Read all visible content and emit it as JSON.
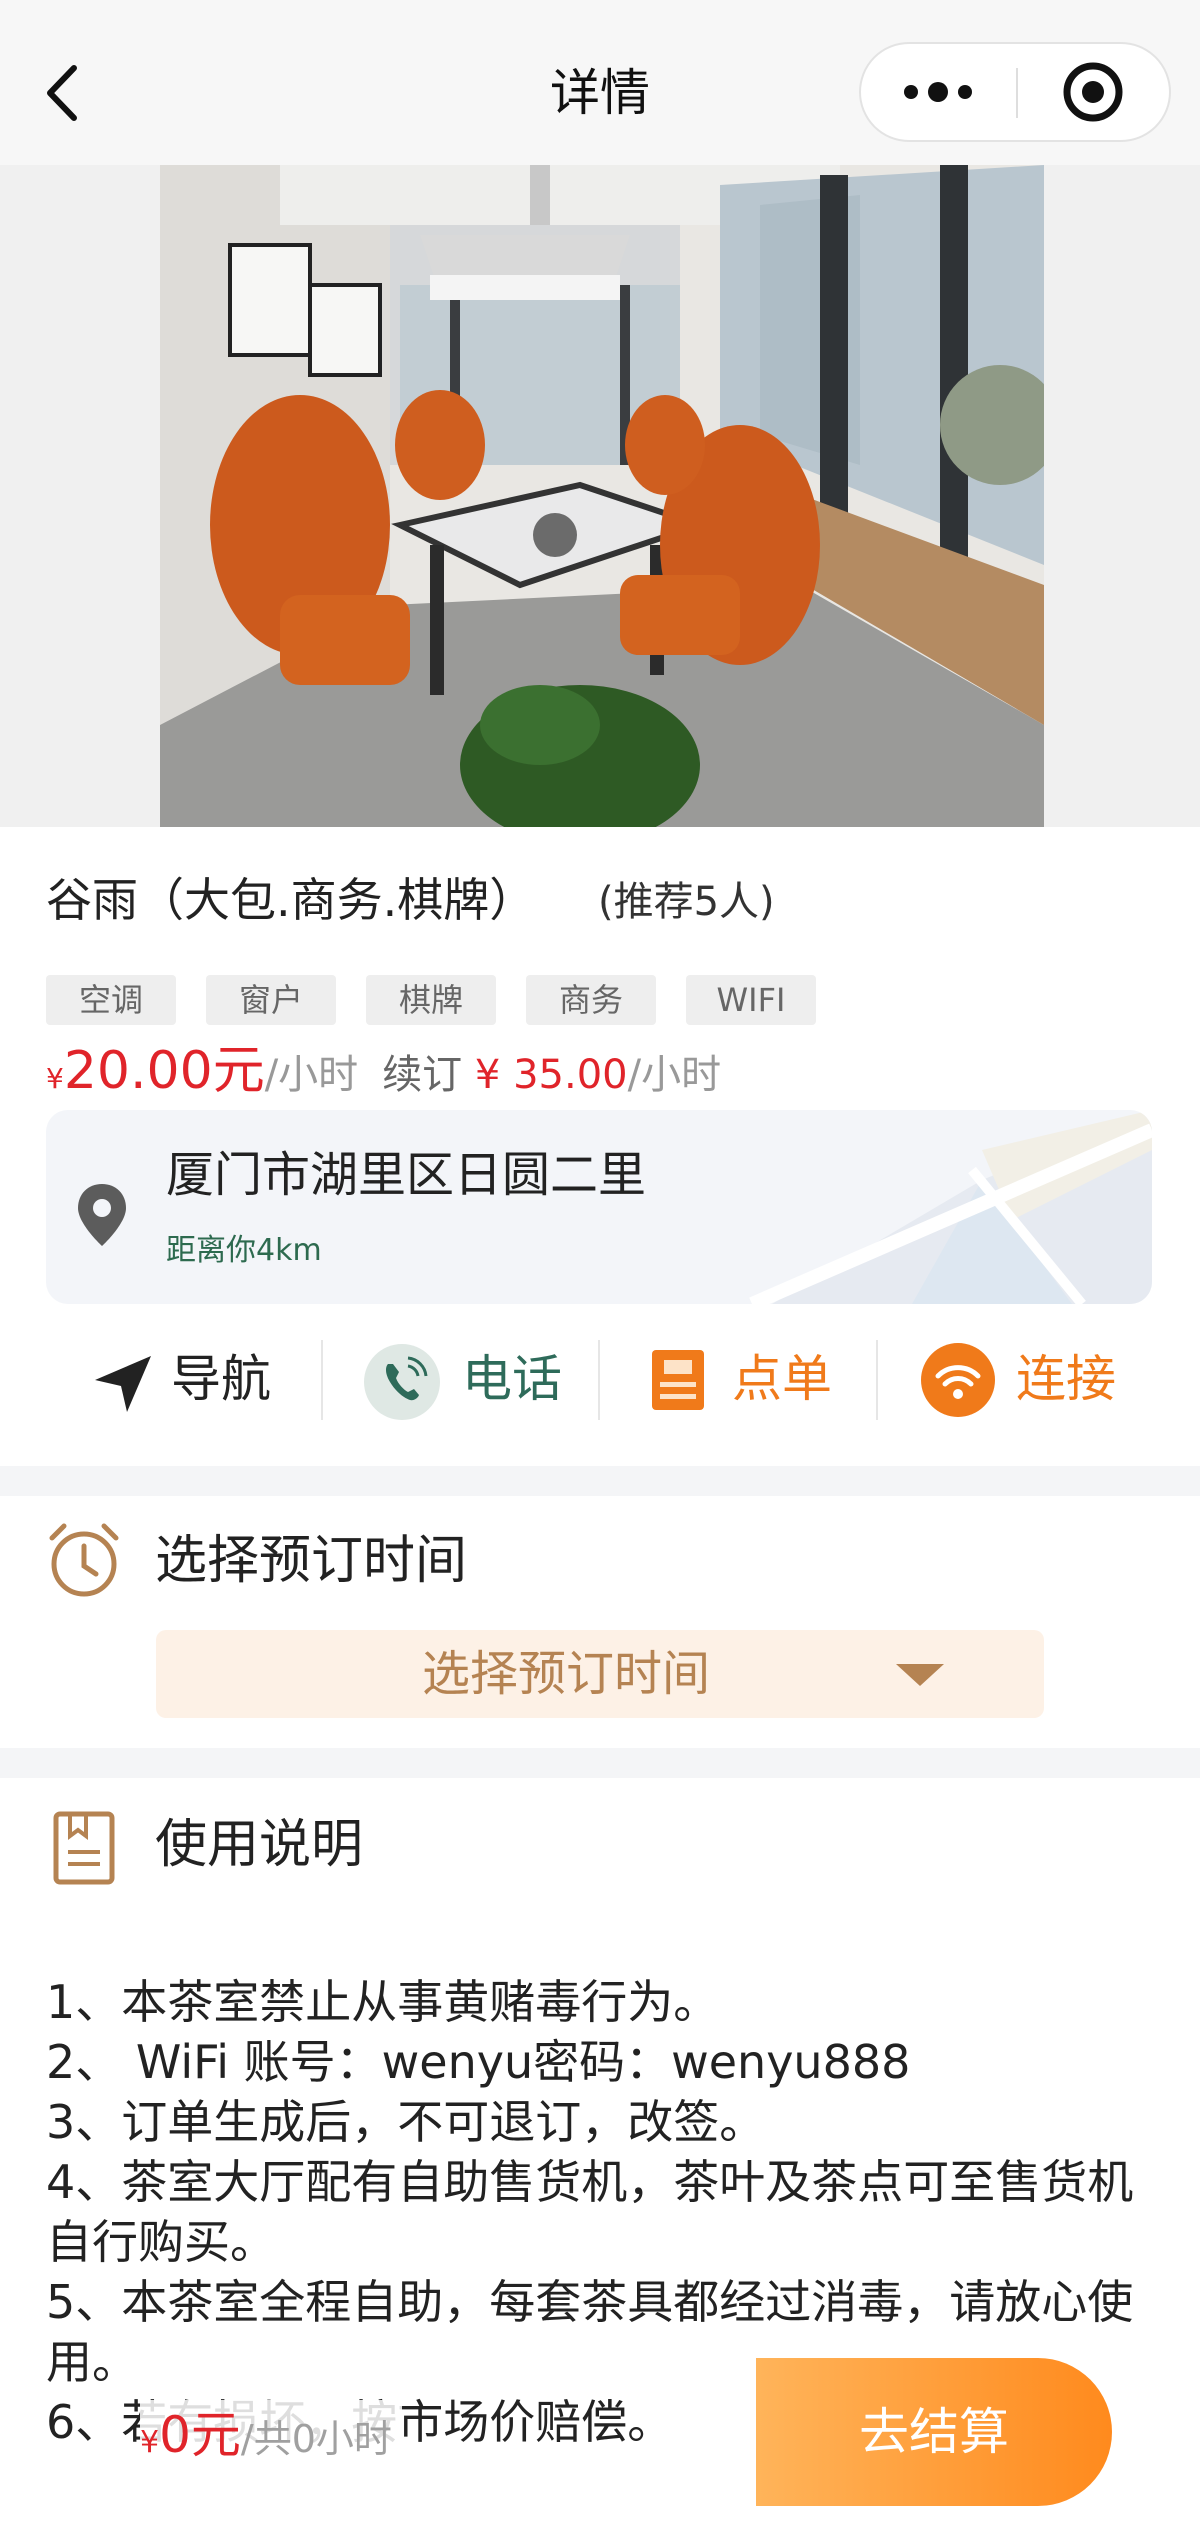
{
  "header": {
    "title": "详情"
  },
  "room": {
    "title": "谷雨（大包.商务.棋牌）",
    "recommend": "(推荐5人)",
    "tags": [
      "空调",
      "窗户",
      "棋牌",
      "商务",
      "WIFI"
    ],
    "price": {
      "currency": "¥",
      "amount": "20.00元",
      "unit": "/小时",
      "renew_label": "续订",
      "renew_currency": "¥",
      "renew_amount": "35.00",
      "renew_unit": "/小时"
    }
  },
  "address": {
    "text": "厦门市湖里区日圆二里",
    "distance": "距离你4km"
  },
  "actions": [
    {
      "label": "导航",
      "icon": "navigation-arrow-icon",
      "color": "#222222"
    },
    {
      "label": "电话",
      "icon": "phone-icon",
      "color": "#2e6b5a"
    },
    {
      "label": "点单",
      "icon": "order-menu-icon",
      "color": "#f07a1a"
    },
    {
      "label": "连接",
      "icon": "wifi-icon",
      "color": "#f07a1a"
    }
  ],
  "booking": {
    "section_title": "选择预订时间",
    "button_label": "选择预订时间",
    "icon": "alarm-clock-icon"
  },
  "usage": {
    "section_title": "使用说明",
    "icon": "document-icon",
    "notes": [
      "1、本茶室禁止从事黄赌毒行为。",
      "2、 WiFi 账号：wenyu密码：wenyu888",
      "3、订单生成后，不可退订，改签。",
      "4、茶室大厅配有自助售货机，茶叶及茶点可至售货机自行购买。",
      "5、本茶室全程自助，每套茶具都经过消毒，请放心使用。",
      "6、若有损坏，按市场价赔偿。"
    ]
  },
  "bottom": {
    "currency": "¥",
    "amount": "0元",
    "hours": "/共0小时",
    "checkout_label": "去结算"
  },
  "colors": {
    "price_red": "#e0242a",
    "accent_orange": "#f07a1a",
    "booking_text": "#b58352",
    "booking_bg": "#fdf1e6",
    "distance_green": "#2d6a4f"
  }
}
